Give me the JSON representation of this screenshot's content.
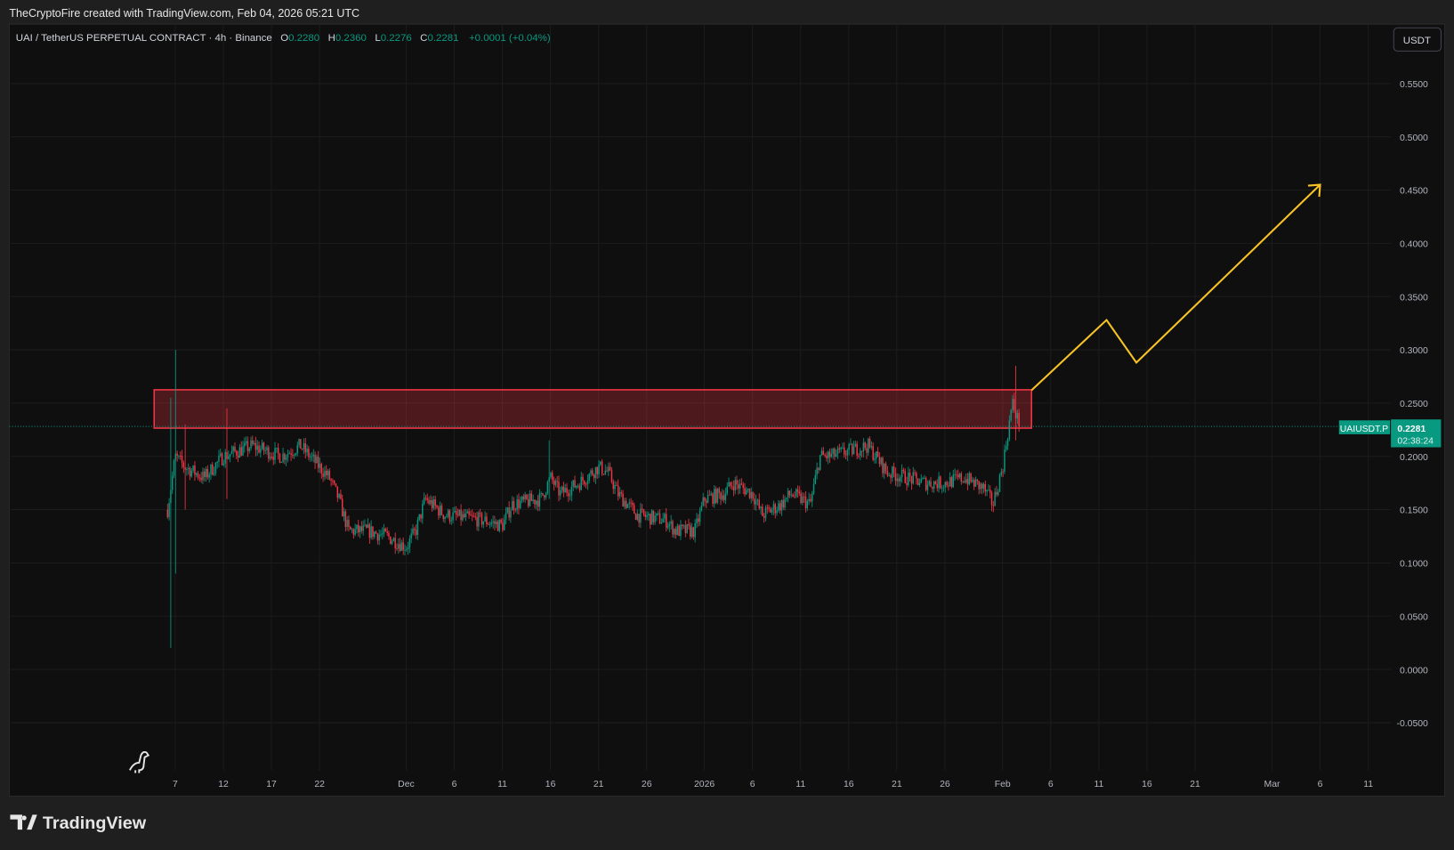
{
  "attribution": "TheCryptoFire created with TradingView.com, Feb 04, 2026 05:21 UTC",
  "legend": {
    "symbol": "UAI / TetherUS PERPETUAL CONTRACT · 4h · Binance",
    "o_label": "O",
    "o": "0.2280",
    "h_label": "H",
    "h": "0.2360",
    "l_label": "L",
    "l": "0.2276",
    "c_label": "C",
    "c": "0.2281",
    "change": "+0.0001 (+0.04%)"
  },
  "currency_button": "USDT",
  "price_tag": {
    "symbol": "UAIUSDT.P",
    "price": "0.2281",
    "countdown": "02:38:24"
  },
  "brand": "TradingView",
  "colors": {
    "up": "#089981",
    "down": "#f23645",
    "zone": "#f23645",
    "projection": "#f7c325",
    "bg": "#0f0f0f"
  },
  "chart_data": {
    "type": "candlestick",
    "interval": "4h",
    "y_ticks": [
      "0.5500",
      "0.5000",
      "0.4500",
      "0.4000",
      "0.3500",
      "0.3000",
      "0.2500",
      "0.2000",
      "0.1500",
      "0.1000",
      "0.0500",
      "0.0000",
      "-0.0500"
    ],
    "y_tick_values": [
      0.55,
      0.5,
      0.45,
      0.4,
      0.35,
      0.3,
      0.25,
      0.2,
      0.15,
      0.1,
      0.05,
      0,
      -0.05
    ],
    "ylim": [
      -0.1,
      0.6
    ],
    "x_ticks": [
      {
        "label": "7",
        "day": 0
      },
      {
        "label": "12",
        "day": 5
      },
      {
        "label": "17",
        "day": 10
      },
      {
        "label": "22",
        "day": 15
      },
      {
        "label": "Dec",
        "day": 24
      },
      {
        "label": "6",
        "day": 29
      },
      {
        "label": "11",
        "day": 34
      },
      {
        "label": "16",
        "day": 39
      },
      {
        "label": "21",
        "day": 44
      },
      {
        "label": "26",
        "day": 49
      },
      {
        "label": "2026",
        "day": 55
      },
      {
        "label": "6",
        "day": 60
      },
      {
        "label": "11",
        "day": 65
      },
      {
        "label": "16",
        "day": 70
      },
      {
        "label": "21",
        "day": 75
      },
      {
        "label": "26",
        "day": 80
      },
      {
        "label": "Feb",
        "day": 86
      },
      {
        "label": "6",
        "day": 91
      },
      {
        "label": "11",
        "day": 96
      },
      {
        "label": "16",
        "day": 101
      },
      {
        "label": "21",
        "day": 106
      },
      {
        "label": "Mar",
        "day": 114
      },
      {
        "label": "6",
        "day": 119
      },
      {
        "label": "11",
        "day": 124
      }
    ],
    "day_zero": "Nov 7, 2025",
    "price_path": [
      [
        -0.8,
        0.15
      ],
      [
        0,
        0.2
      ],
      [
        1,
        0.19
      ],
      [
        3,
        0.18
      ],
      [
        5,
        0.2
      ],
      [
        8,
        0.21
      ],
      [
        11,
        0.2
      ],
      [
        13,
        0.21
      ],
      [
        15,
        0.19
      ],
      [
        16,
        0.18
      ],
      [
        17,
        0.16
      ],
      [
        18,
        0.13
      ],
      [
        20,
        0.13
      ],
      [
        22,
        0.125
      ],
      [
        24,
        0.115
      ],
      [
        25,
        0.13
      ],
      [
        26,
        0.16
      ],
      [
        28,
        0.145
      ],
      [
        32,
        0.14
      ],
      [
        34,
        0.135
      ],
      [
        35,
        0.155
      ],
      [
        38,
        0.16
      ],
      [
        39,
        0.18
      ],
      [
        40,
        0.165
      ],
      [
        42,
        0.175
      ],
      [
        44,
        0.19
      ],
      [
        45,
        0.185
      ],
      [
        46,
        0.165
      ],
      [
        48,
        0.145
      ],
      [
        51,
        0.14
      ],
      [
        52,
        0.13
      ],
      [
        54,
        0.13
      ],
      [
        55,
        0.16
      ],
      [
        57,
        0.165
      ],
      [
        58,
        0.175
      ],
      [
        60,
        0.165
      ],
      [
        61,
        0.145
      ],
      [
        63,
        0.155
      ],
      [
        64,
        0.165
      ],
      [
        66,
        0.155
      ],
      [
        67,
        0.2
      ],
      [
        68,
        0.2
      ],
      [
        70,
        0.205
      ],
      [
        72,
        0.21
      ],
      [
        74,
        0.185
      ],
      [
        76,
        0.18
      ],
      [
        78,
        0.175
      ],
      [
        80,
        0.175
      ],
      [
        82,
        0.18
      ],
      [
        84,
        0.17
      ],
      [
        85,
        0.155
      ],
      [
        86,
        0.19
      ],
      [
        87,
        0.25
      ],
      [
        87.8,
        0.228
      ]
    ],
    "spikes": [
      {
        "day": -0.5,
        "high": 0.255,
        "low": 0.02
      },
      {
        "day": 0.1,
        "high": 0.3,
        "low": 0.09
      },
      {
        "day": 1.0,
        "high": 0.23,
        "low": 0.15
      },
      {
        "day": 5.4,
        "high": 0.245,
        "low": 0.16
      },
      {
        "day": 38.8,
        "high": 0.215,
        "low": 0.16
      },
      {
        "day": 87.3,
        "high": 0.285,
        "low": 0.215
      }
    ],
    "last_price": 0.2281,
    "resistance_zone": {
      "top": 0.2625,
      "bottom": 0.2265,
      "from_day": -2,
      "to_day": 89
    },
    "projection_path": [
      [
        89,
        0.262
      ],
      [
        96.8,
        0.328
      ],
      [
        99.9,
        0.288
      ],
      [
        119,
        0.455
      ]
    ]
  }
}
